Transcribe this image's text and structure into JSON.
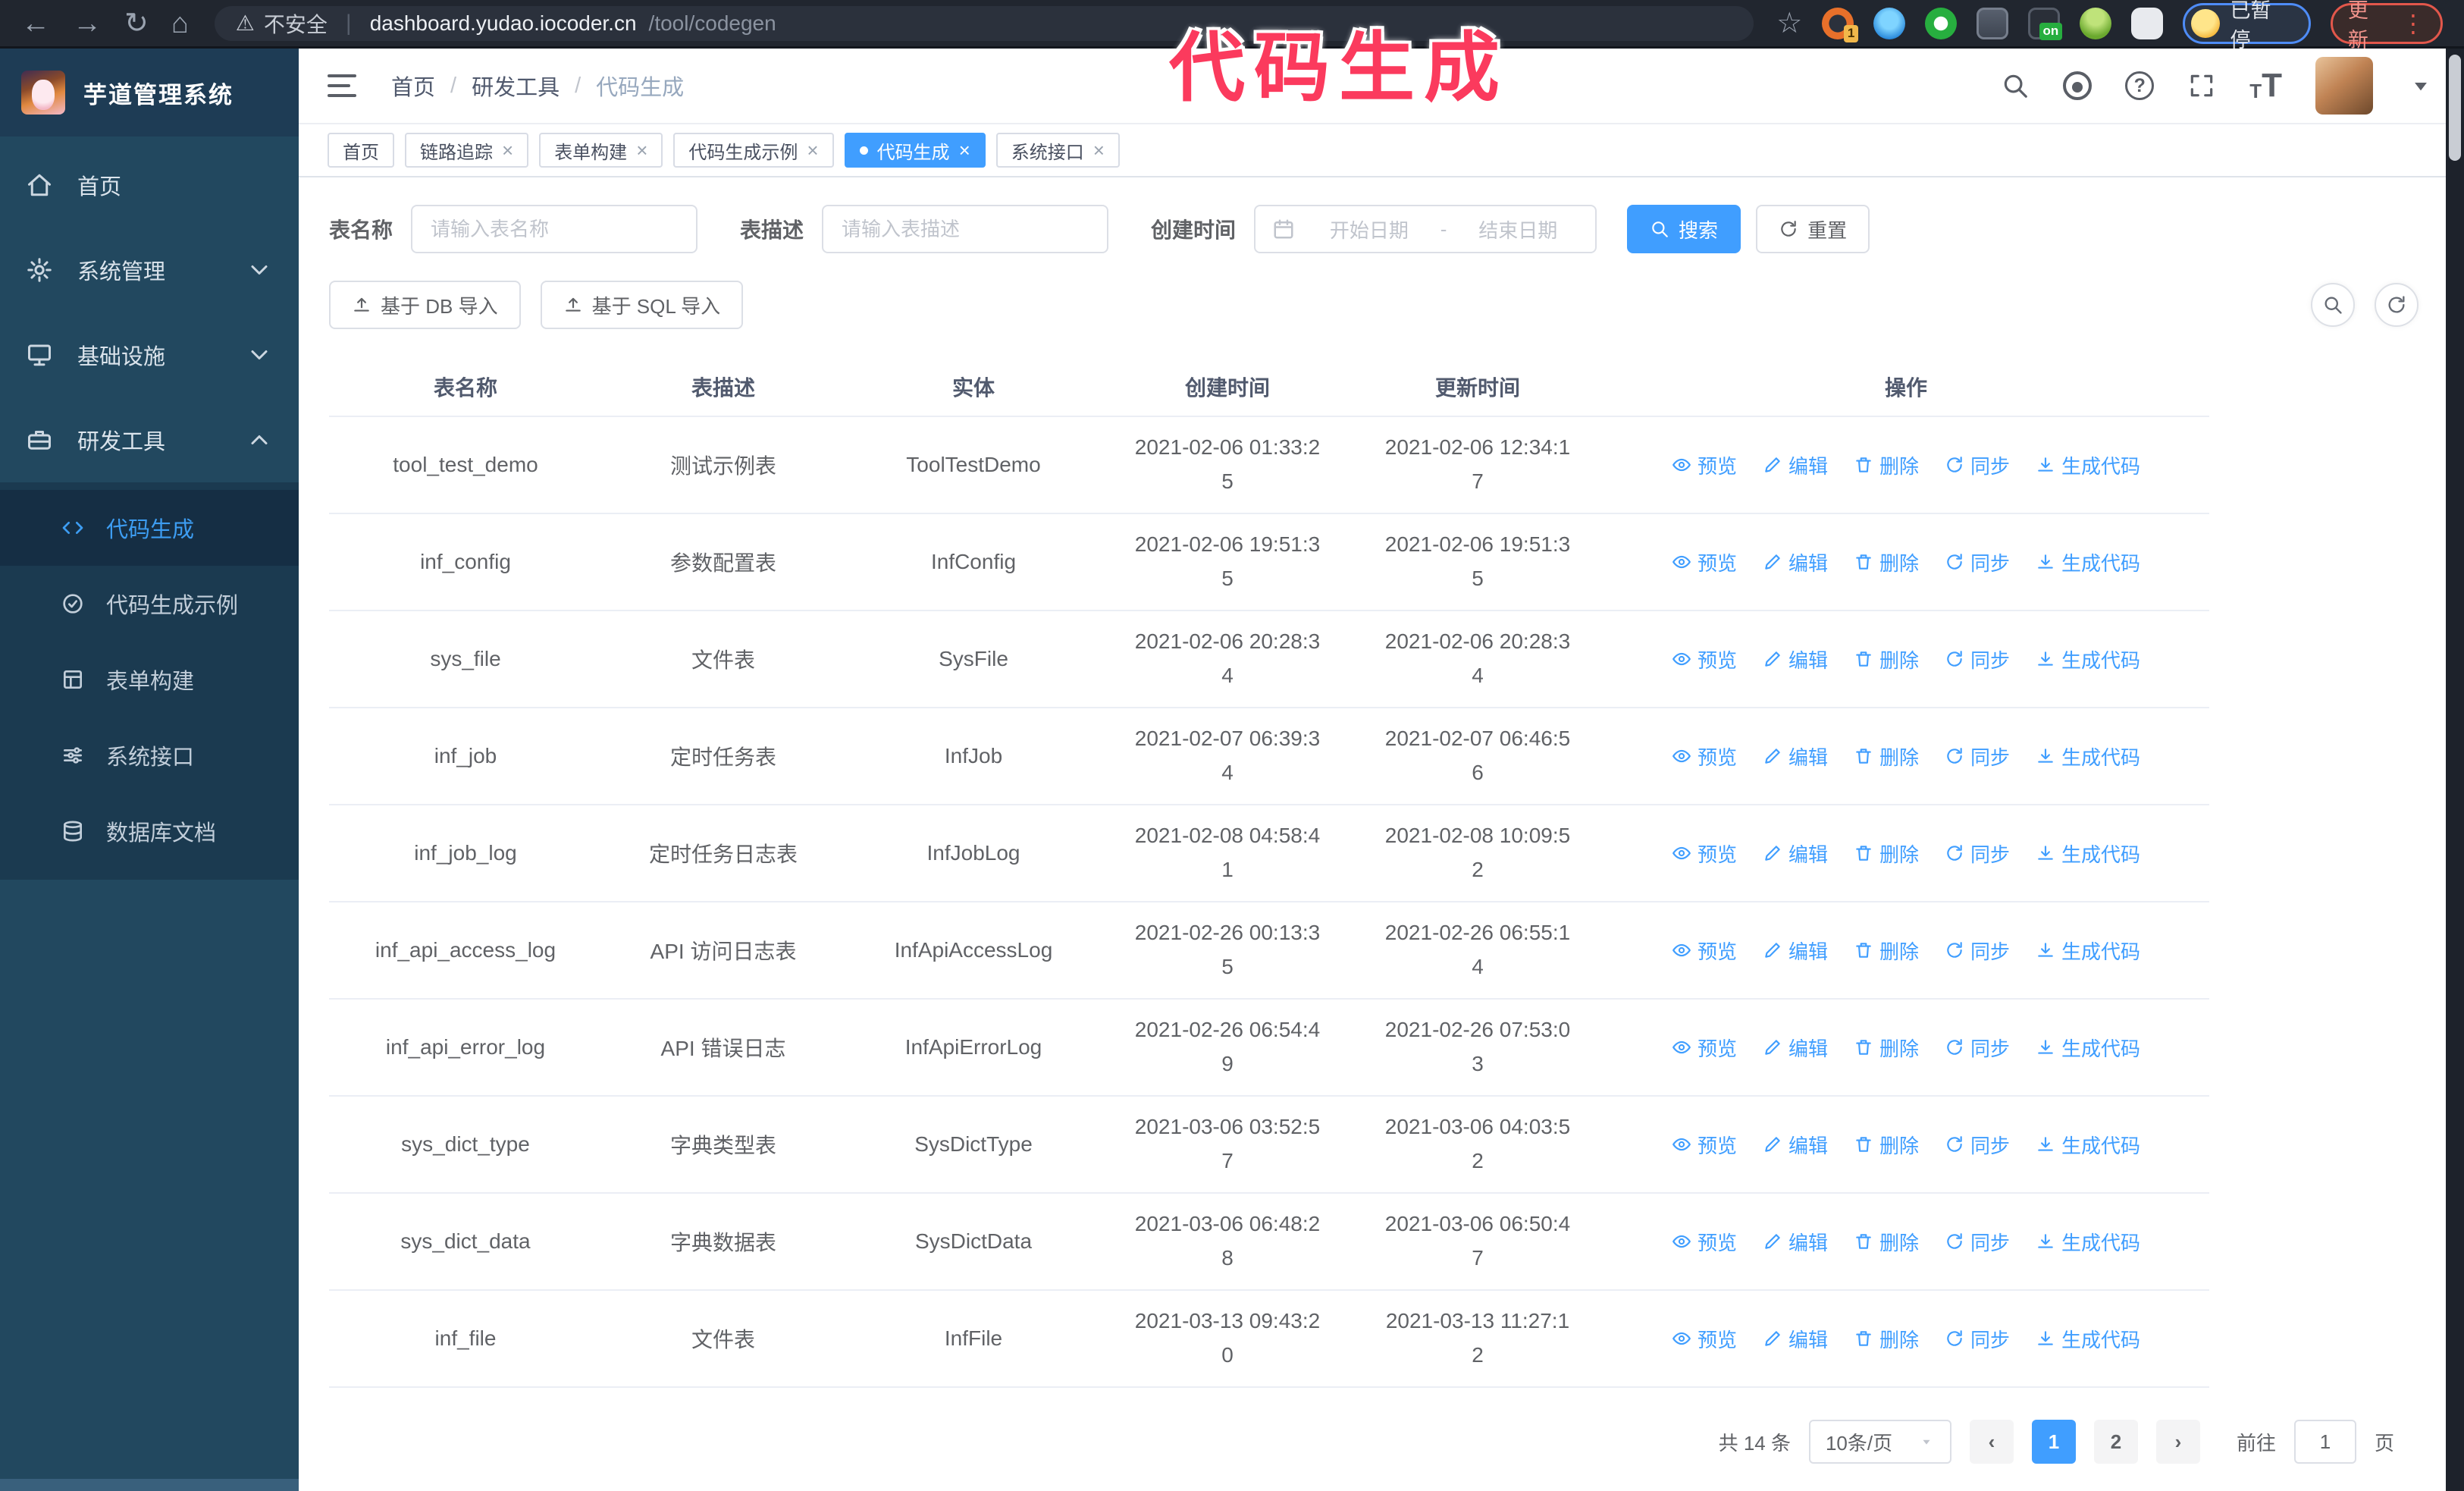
{
  "colors": {
    "primary": "#409eff",
    "annotation": "#fb3a5d",
    "sidebar": "#22485f",
    "submenu": "#1b3a50"
  },
  "icons": {
    "back": "←",
    "forward": "→",
    "reload": "↻",
    "home": "⌂",
    "warning": "⚠",
    "divider": "|",
    "star": "☆",
    "dots": "⋮",
    "close": "×",
    "slash": "/",
    "question": "?",
    "prev": "‹",
    "next": "›",
    "t_small": "T",
    "t_large": "T"
  },
  "browser": {
    "security_label": "不安全",
    "url_domain": "dashboard.yudao.iocoder.cn",
    "url_path": "/tool/codegen",
    "profile_chip": "已暂停",
    "update_label": "更新"
  },
  "annotation": {
    "text": "代码生成"
  },
  "header": {
    "logo_title": "芋道管理系统",
    "breadcrumb": [
      "首页",
      "研发工具",
      "代码生成"
    ]
  },
  "sidebar": {
    "items": [
      {
        "label": "首页"
      },
      {
        "label": "系统管理"
      },
      {
        "label": "基础设施"
      },
      {
        "label": "研发工具"
      }
    ],
    "submenu": [
      {
        "label": "代码生成"
      },
      {
        "label": "代码生成示例"
      },
      {
        "label": "表单构建"
      },
      {
        "label": "系统接口"
      },
      {
        "label": "数据库文档"
      }
    ]
  },
  "tags": [
    {
      "label": "首页"
    },
    {
      "label": "链路追踪"
    },
    {
      "label": "表单构建"
    },
    {
      "label": "代码生成示例"
    },
    {
      "label": "代码生成"
    },
    {
      "label": "系统接口"
    }
  ],
  "filters": {
    "name_label": "表名称",
    "name_placeholder": "请输入表名称",
    "desc_label": "表描述",
    "desc_placeholder": "请输入表描述",
    "date_label": "创建时间",
    "date_start": "开始日期",
    "date_separator": "-",
    "date_end": "结束日期",
    "search_label": "搜索",
    "reset_label": "重置"
  },
  "toolbar": {
    "import_db_label": "基于 DB 导入",
    "import_sql_label": "基于 SQL 导入"
  },
  "table": {
    "columns": [
      "表名称",
      "表描述",
      "实体",
      "创建时间",
      "更新时间",
      "操作"
    ],
    "actions": {
      "preview": "预览",
      "edit": "编辑",
      "del": "删除",
      "sync": "同步",
      "generate": "生成代码"
    },
    "rows": [
      {
        "name": "tool_test_demo",
        "desc": "测试示例表",
        "entity": "ToolTestDemo",
        "created": "2021-02-06 01:33:25",
        "updated": "2021-02-06 12:34:17"
      },
      {
        "name": "inf_config",
        "desc": "参数配置表",
        "entity": "InfConfig",
        "created": "2021-02-06 19:51:35",
        "updated": "2021-02-06 19:51:35"
      },
      {
        "name": "sys_file",
        "desc": "文件表",
        "entity": "SysFile",
        "created": "2021-02-06 20:28:34",
        "updated": "2021-02-06 20:28:34"
      },
      {
        "name": "inf_job",
        "desc": "定时任务表",
        "entity": "InfJob",
        "created": "2021-02-07 06:39:34",
        "updated": "2021-02-07 06:46:56"
      },
      {
        "name": "inf_job_log",
        "desc": "定时任务日志表",
        "entity": "InfJobLog",
        "created": "2021-02-08 04:58:41",
        "updated": "2021-02-08 10:09:52"
      },
      {
        "name": "inf_api_access_log",
        "desc": "API 访问日志表",
        "entity": "InfApiAccessLog",
        "created": "2021-02-26 00:13:35",
        "updated": "2021-02-26 06:55:14"
      },
      {
        "name": "inf_api_error_log",
        "desc": "API 错误日志",
        "entity": "InfApiErrorLog",
        "created": "2021-02-26 06:54:49",
        "updated": "2021-02-26 07:53:03"
      },
      {
        "name": "sys_dict_type",
        "desc": "字典类型表",
        "entity": "SysDictType",
        "created": "2021-03-06 03:52:57",
        "updated": "2021-03-06 04:03:52"
      },
      {
        "name": "sys_dict_data",
        "desc": "字典数据表",
        "entity": "SysDictData",
        "created": "2021-03-06 06:48:28",
        "updated": "2021-03-06 06:50:47"
      },
      {
        "name": "inf_file",
        "desc": "文件表",
        "entity": "InfFile",
        "created": "2021-03-13 09:43:20",
        "updated": "2021-03-13 11:27:12"
      }
    ]
  },
  "pagination": {
    "total": "共 14 条",
    "page_size": "10条/页",
    "pages": [
      "1",
      "2"
    ],
    "goto_label": "前往",
    "goto_value": "1",
    "page_unit": "页"
  }
}
